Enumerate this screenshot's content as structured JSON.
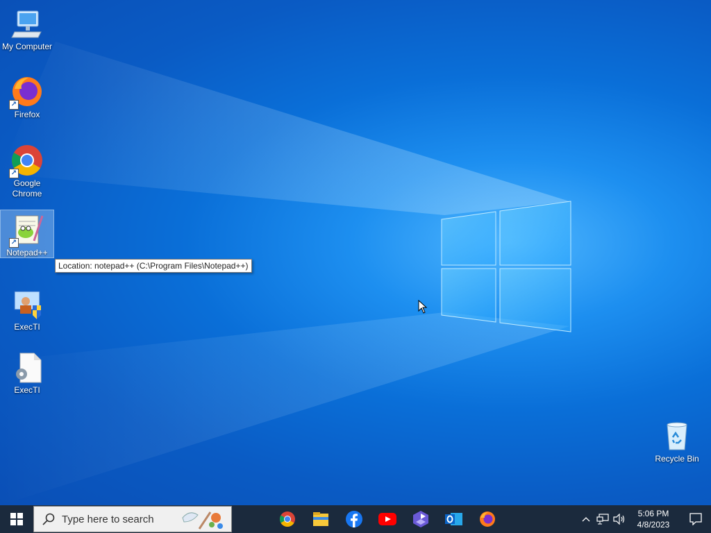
{
  "desktop": {
    "icons": [
      {
        "label": "My Computer",
        "icon": "computer-icon"
      },
      {
        "label": "Firefox",
        "icon": "firefox-icon"
      },
      {
        "label": "Google Chrome",
        "icon": "chrome-icon"
      },
      {
        "label": "Notepad++",
        "icon": "notepad-plus-plus-icon"
      },
      {
        "label": "ExecTI",
        "icon": "execti-admin-icon"
      },
      {
        "label": "ExecTI",
        "icon": "execti-settings-file-icon"
      },
      {
        "label": "Recycle Bin",
        "icon": "recycle-bin-icon"
      }
    ],
    "tooltip": "Location: notepad++ (C:\\Program Files\\Notepad++)"
  },
  "taskbar": {
    "search_placeholder": "Type here to search",
    "apps": [
      "chrome-icon",
      "file-explorer-icon",
      "facebook-icon",
      "youtube-icon",
      "vpn-shield-icon",
      "outlook-icon",
      "firefox-icon"
    ],
    "clock_time": "5:06 PM",
    "clock_date": "4/8/2023"
  },
  "colors": {
    "taskbar_bg": "#1b2a3d",
    "desktop_accent": "#0a6fd8"
  }
}
